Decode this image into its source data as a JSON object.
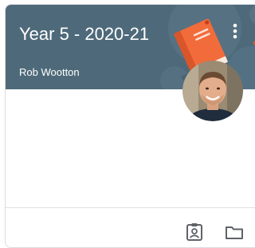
{
  "card": {
    "title": "Year 5 - 2020-21",
    "teacher": "Rob Wootton",
    "header_color": "#4e6a7a",
    "accent_color": "#f26b3a"
  },
  "header": {
    "more_icon": "more-vert-icon",
    "illustration": "book-illustration"
  },
  "footer": {
    "icons": [
      "assignment-ind-icon",
      "folder-icon"
    ]
  }
}
